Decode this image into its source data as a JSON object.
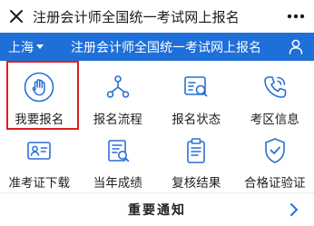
{
  "titlebar": {
    "title": "注册会计师全国统一考试网上报名",
    "close_icon": "close-icon",
    "more_icon": "more-icon"
  },
  "header": {
    "location": "上海",
    "title": "注册会计师全国统一考试网上报名",
    "user_icon": "user-icon"
  },
  "menu": [
    {
      "label": "我要报名",
      "icon": "hand-icon",
      "highlighted": true
    },
    {
      "label": "报名流程",
      "icon": "flow-icon"
    },
    {
      "label": "报名状态",
      "icon": "status-card-icon"
    },
    {
      "label": "考区信息",
      "icon": "phone-icon"
    },
    {
      "label": "准考证下载",
      "icon": "id-card-icon"
    },
    {
      "label": "当年成绩",
      "icon": "scores-icon"
    },
    {
      "label": "复核结果",
      "icon": "clipboard-icon"
    },
    {
      "label": "合格证验证",
      "icon": "shield-check-icon"
    }
  ],
  "notice": {
    "title": "重要通知"
  },
  "colors": {
    "brand_blue": "#1f6fd8",
    "highlight_red": "#e02020",
    "icon_blue": "#2a6fd6"
  }
}
